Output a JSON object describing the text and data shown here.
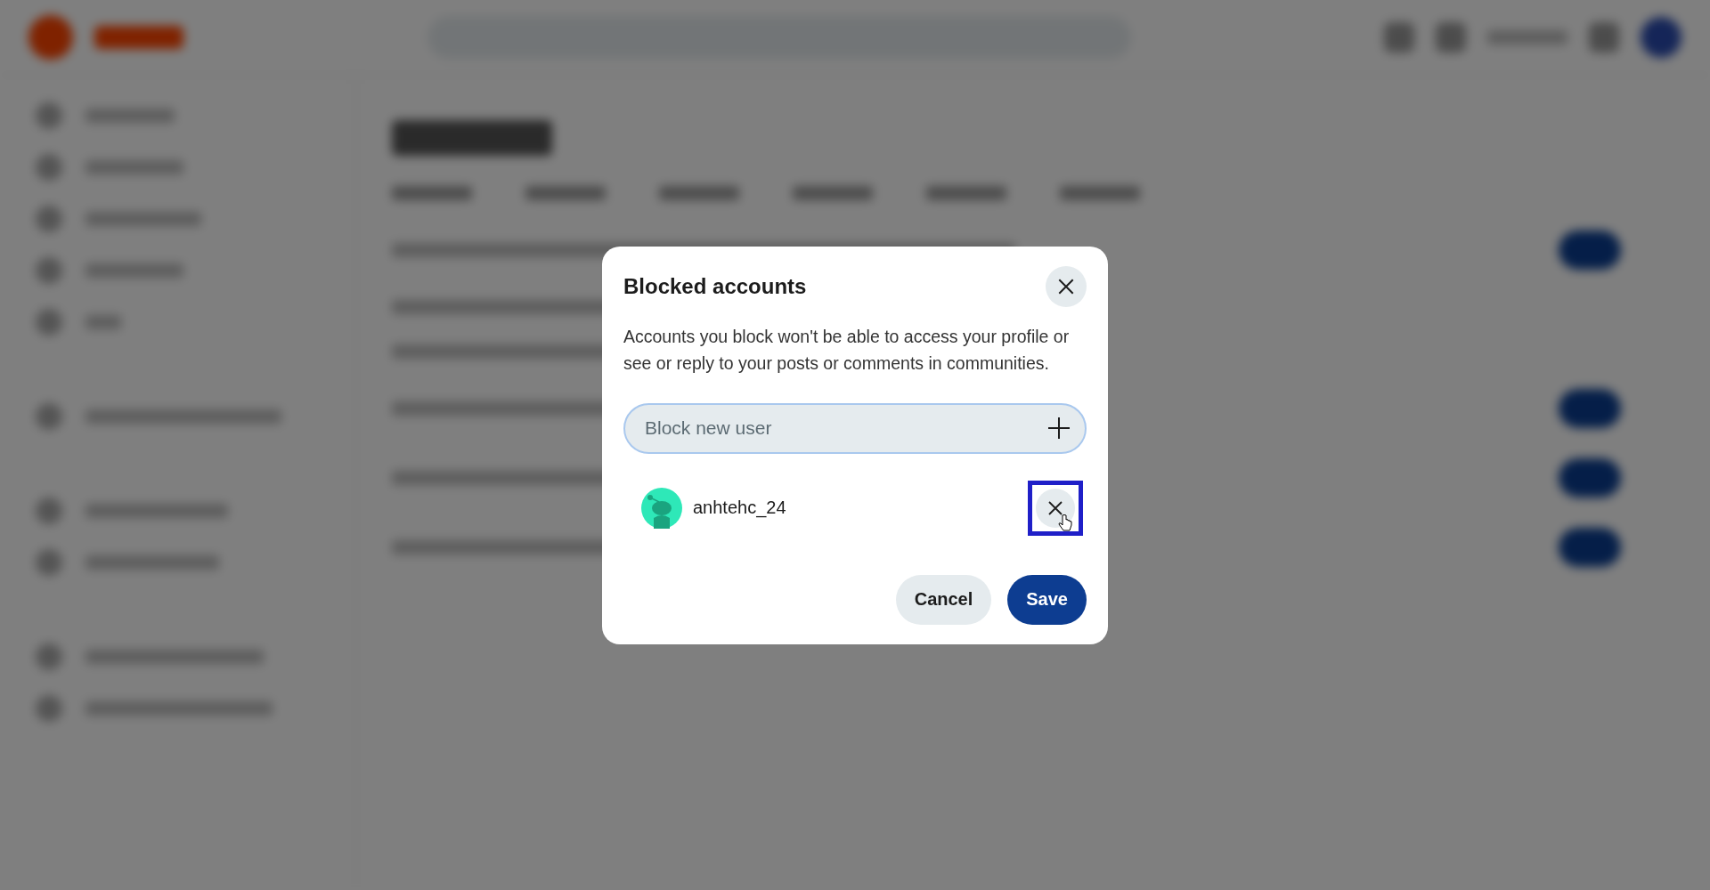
{
  "dialog": {
    "title": "Blocked accounts",
    "description": "Accounts you block won't be able to access your profile or see or reply to your posts or comments in communities.",
    "field": {
      "placeholder": "Block new user",
      "focused": true
    },
    "blocked_users": [
      {
        "username": "anhtehc_24",
        "remove_highlighted": true
      }
    ],
    "buttons": [
      {
        "label": "Cancel",
        "kind": "secondary"
      },
      {
        "label": "Save",
        "kind": "primary"
      }
    ]
  }
}
